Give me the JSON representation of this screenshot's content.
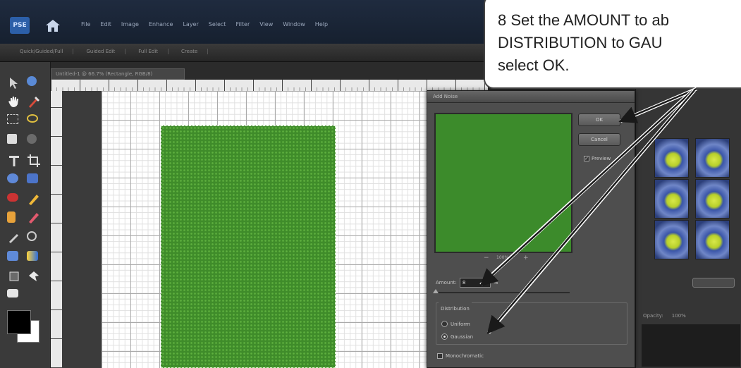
{
  "menubar": {
    "logo_text": "PSE",
    "items": [
      "File",
      "Edit",
      "Image",
      "Enhance",
      "Layer",
      "Select",
      "Filter",
      "View",
      "Window",
      "Help"
    ]
  },
  "modebar": {
    "tabs": [
      "Quick/Guided/Full",
      "Guided Edit",
      "Full Edit",
      "Create"
    ]
  },
  "document": {
    "tab_title": "Untitled-1 @ 66.7% (Rectangle, RGB/8)"
  },
  "dialog": {
    "title": "Add Noise",
    "ok_label": "OK",
    "cancel_label": "Cancel",
    "preview_label": "Preview",
    "zoom_minus": "−",
    "zoom_value": "100%",
    "zoom_plus": "+",
    "amount_label": "Amount:",
    "amount_value": "8",
    "amount_unit": "%",
    "distribution_label": "Distribution",
    "uniform_label": "Uniform",
    "gaussian_label": "Gaussian",
    "monochromatic_label": "Monochromatic",
    "preview_color": "#3c8b2b"
  },
  "rightpanel": {
    "tabs": [
      "Opacity:",
      "100%"
    ]
  },
  "callout": {
    "line1": "8  Set the AMOUNT to ab",
    "line2": "DISTRIBUTION to GAU",
    "line3": "select OK."
  },
  "colors": {
    "accent_green": "#3f8c2a",
    "menubar": "#1f2b3f",
    "callout_border": "#444444"
  }
}
